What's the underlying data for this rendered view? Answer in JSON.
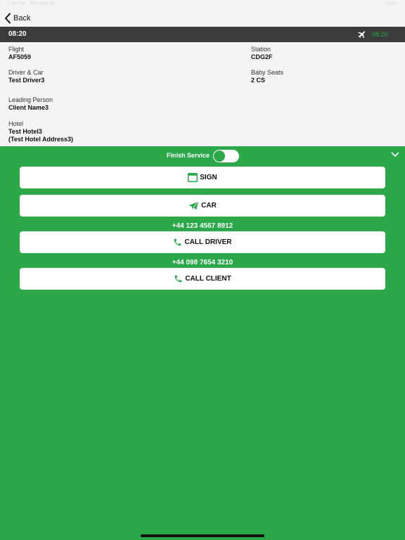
{
  "status_bar": {
    "time": "1:39 PM",
    "date": "Thu Mar 16",
    "battery": "81%"
  },
  "nav": {
    "back_label": "Back"
  },
  "header": {
    "time_left": "08:20",
    "time_right": "08:20",
    "accent_color": "#2ba84a"
  },
  "details": {
    "flight": {
      "label": "Flight",
      "value": "AF5059"
    },
    "station": {
      "label": "Station",
      "value": "CDG2F"
    },
    "driver_car": {
      "label": "Driver & Car",
      "value": "Test Driver3"
    },
    "baby_seats": {
      "label": "Baby Seats",
      "value": "2 CS"
    },
    "leading_person": {
      "label": "Leading Person",
      "value": "Client Name3"
    },
    "hotel": {
      "label": "Hotel",
      "value": "Test Hotel3",
      "address": "(Test Hotel Address3)"
    }
  },
  "actions": {
    "finish_service_label": "Finish Service",
    "finish_service_on": true,
    "sign_label": "SIGN",
    "car_label": "CAR",
    "driver_phone": "+44 123 4567 8912",
    "call_driver_label": "CALL DRIVER",
    "client_phone": "+44 098 7654 3210",
    "call_client_label": "CALL CLIENT"
  },
  "icons": {
    "back": "chevron-left-icon",
    "flight": "airplane-icon",
    "collapse": "chevron-down-icon",
    "sign": "calendar-icon",
    "car": "send-icon",
    "call": "phone-icon"
  },
  "colors": {
    "background_green": "#2ba84a",
    "header_dark": "#3b3b3b",
    "panel_light": "#f4f4f4"
  }
}
